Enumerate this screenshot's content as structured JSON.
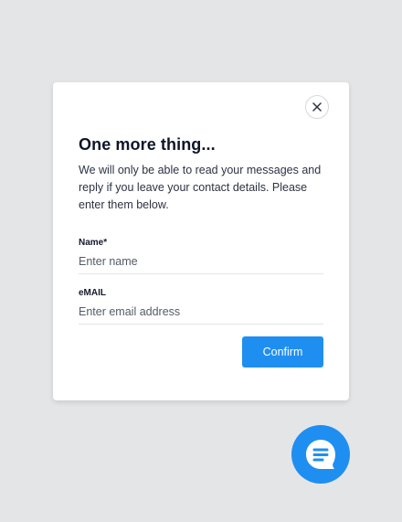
{
  "modal": {
    "title": "One more thing...",
    "description": "We will only be able to read your messages and reply if you leave your contact details. Please enter them below.",
    "name_label": "Name*",
    "name_placeholder": "Enter name",
    "email_label": "eMAIL",
    "email_placeholder": "Enter email address",
    "confirm_label": "Confirm",
    "close_icon": "close-icon"
  },
  "chat_launcher": {
    "icon": "chat-bubble-icon"
  },
  "colors": {
    "background": "#e4e5e7",
    "accent": "#1f8ef1",
    "card": "#ffffff"
  }
}
